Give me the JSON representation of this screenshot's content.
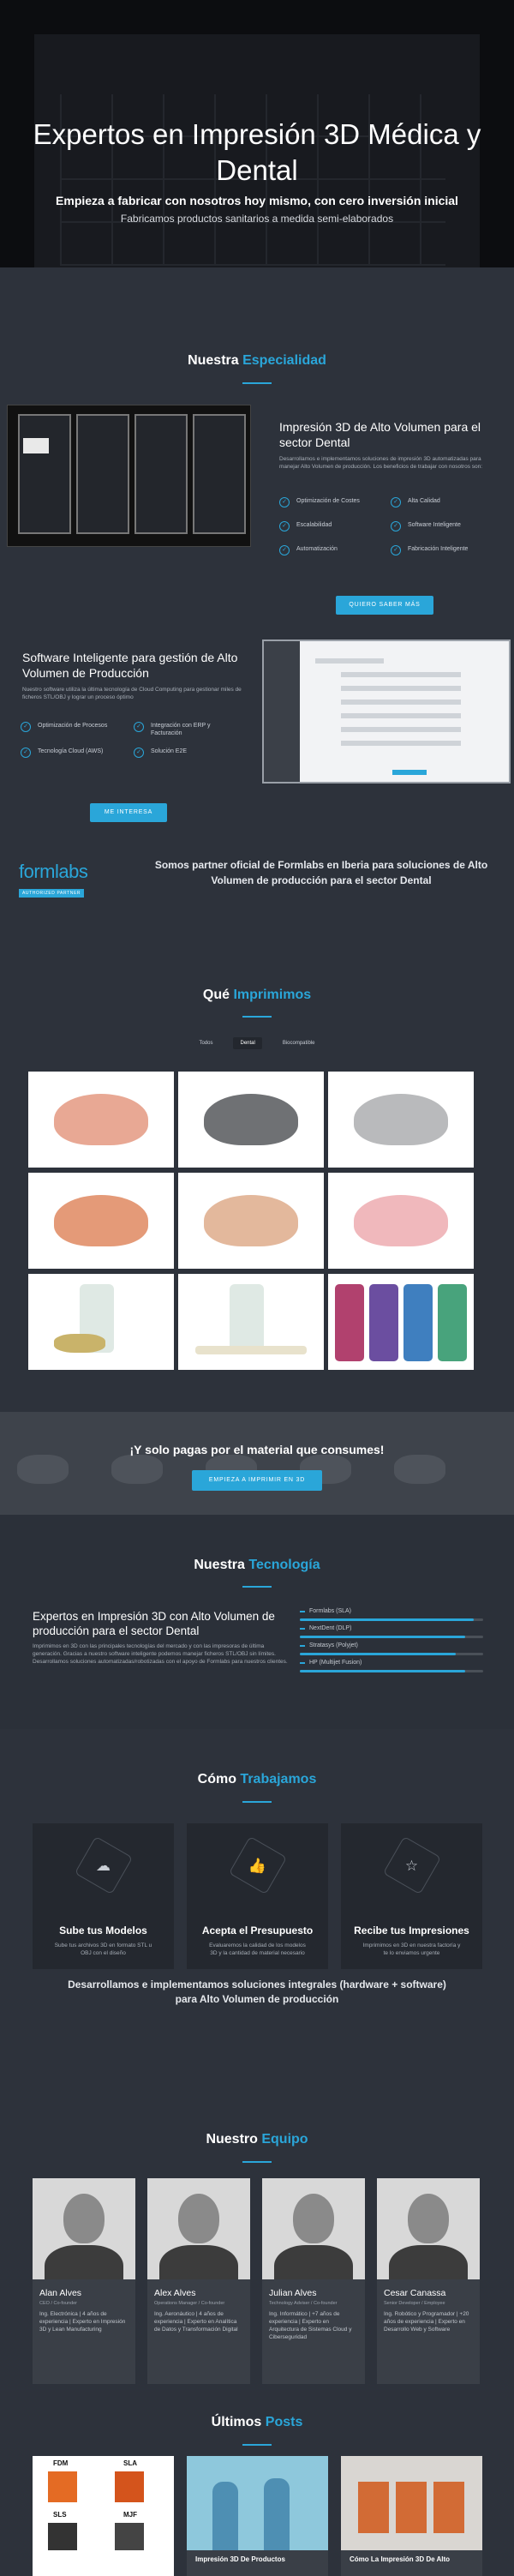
{
  "hero": {
    "title": "Expertos en Impresión 3D Médica y Dental",
    "subtitle": "Empieza a fabricar con nosotros hoy mismo, con cero inversión inicial",
    "tagline": "Fabricamos productos sanitarios a medida semi-elaborados"
  },
  "especialidad": {
    "title_a": "Nuestra ",
    "title_b": "Especialidad",
    "card1": {
      "title": "Impresión 3D de Alto Volumen para el sector Dental",
      "desc": "Desarrollamos e implementamos soluciones de impresión 3D automatizadas para manejar Alto Volumen de producción. Los beneficios de trabajar con nosotros son:",
      "features": [
        "Optimización de Costes",
        "Alta Calidad",
        "Escalabilidad",
        "Software Inteligente",
        "Automatización",
        "Fabricación Inteligente"
      ],
      "button": "QUIERO SABER MÁS"
    },
    "card2": {
      "title": "Software Inteligente para gestión de Alto Volumen de Producción",
      "desc": "Nuestro software utiliza la última tecnología de Cloud Computing para gestionar miles de ficheros STL/OBJ y lograr un proceso óptimo",
      "features": [
        "Optimización de Procesos",
        "Integración con ERP y Facturación",
        "Tecnología Cloud (AWS)",
        "Solución E2E"
      ],
      "button": "ME INTERESA"
    },
    "formlabs_logo": "formlabs",
    "formlabs_badge": "AUTHORIZED PARTNER",
    "partner_text": "Somos partner oficial de Formlabs en Iberia para soluciones de Alto Volumen de producción para el sector Dental"
  },
  "imprimimos": {
    "title_a": "Qué ",
    "title_b": "Imprimimos",
    "filters": [
      "Todos",
      "Dental",
      "Biocompatible"
    ]
  },
  "banner": {
    "text": "¡Y solo pagas por el material que consumes!",
    "button": "EMPIEZA A IMPRIMIR EN 3D"
  },
  "tecnologia": {
    "title_a": "Nuestra ",
    "title_b": "Tecnología",
    "heading": "Expertos en Impresión 3D con Alto Volumen de producción para el sector Dental",
    "desc": "Imprimimos en 3D con las principales tecnologías del mercado y con las impresoras de última generación. Gracias a nuestro software inteligente podemos manejar ficheros STL/OBJ sin límites. Desarrollamos soluciones automatizadas/robotizadas con el apoyo de Formlabs para nuestros clientes.",
    "bars": [
      {
        "label": "Formlabs (SLA)",
        "level": 0.95
      },
      {
        "label": "NextDent (DLP)",
        "level": 0.9
      },
      {
        "label": "Stratasys (Polyjet)",
        "level": 0.85
      },
      {
        "label": "HP (Multijet Fusion)",
        "level": 0.9
      }
    ]
  },
  "como": {
    "title_a": "Cómo ",
    "title_b": "Trabajamos",
    "steps": [
      {
        "title": "Sube tus Modelos",
        "desc": "Sube tus archivos 3D en formato STL u OBJ con el diseño",
        "icon": "cloud-upload-icon"
      },
      {
        "title": "Acepta el Presupuesto",
        "desc": "Evaluaremos la calidad de los modelos 3D y la cantidad de material necesario",
        "icon": "thumbs-up-icon"
      },
      {
        "title": "Recibe tus Impresiones",
        "desc": "Imprimimos en 3D en nuestra factoría y te lo enviamos urgente",
        "icon": "star-icon"
      }
    ],
    "bottom": "Desarrollamos e implementamos soluciones integrales (hardware + software) para Alto Volumen de producción"
  },
  "equipo": {
    "title_a": "Nuestro ",
    "title_b": "Equipo",
    "members": [
      {
        "name": "Alan Alves",
        "role": "CEO / Co-founder",
        "bio": "Ing. Electrónica | 4 años de experiencia | Experto en Impresión 3D y Lean Manufacturing"
      },
      {
        "name": "Alex Alves",
        "role": "Operations Manager / Co-founder",
        "bio": "Ing. Aeronáutico | 4 años de experiencia | Experto en Analítica de Datos y Transformación Digital"
      },
      {
        "name": "Julian Alves",
        "role": "Technology Adviser / Co-founder",
        "bio": "Ing. Informático | +7 años de experiencia | Experto en Arquitectura de Sistemas Cloud y Ciberseguridad"
      },
      {
        "name": "Cesar Canassa",
        "role": "Senior Developer / Employee",
        "bio": "Ing. Robótico y Programador | +20 años de experiencia | Experto en Desarrollo Web y Software"
      }
    ]
  },
  "posts": {
    "title_a": "Últimos ",
    "title_b": "Posts",
    "items": [
      {
        "title": "",
        "labels": [
          "FDM",
          "SLA",
          "SLS",
          "MJF"
        ]
      },
      {
        "title": "Impresión 3D De Productos",
        "labels": []
      },
      {
        "title": "Cómo La Impresión 3D De Alto",
        "labels": []
      }
    ]
  },
  "colors": {
    "accent": "#2aa6d9",
    "background": "#2d323b",
    "hero": "#0c0d10"
  }
}
